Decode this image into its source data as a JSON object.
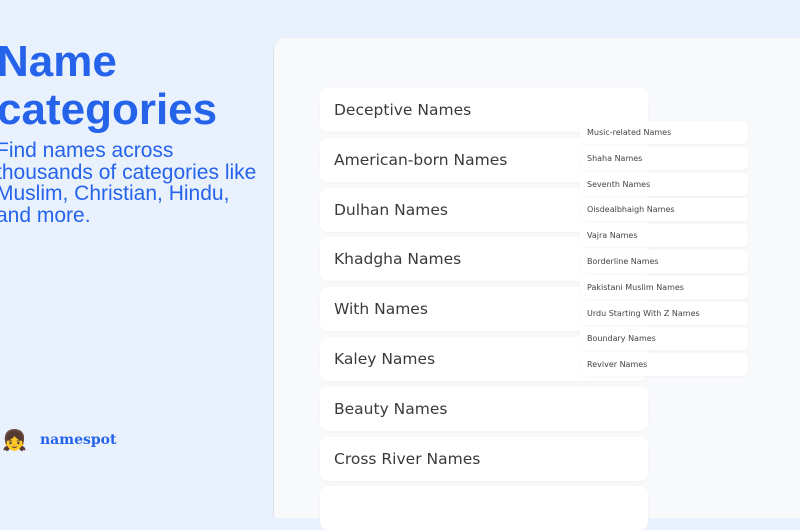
{
  "hero": {
    "title_line1": "Name",
    "title_line2": "categories",
    "description": "Find names across thousands of categories like Muslim, Christian, Hindu, and more."
  },
  "brand": {
    "emoji": "👧",
    "name": "namespot"
  },
  "categories": [
    "Deceptive Names",
    "American-born Names",
    "Dulhan Names",
    "Khadgha Names",
    "With Names",
    "Kaley Names",
    "Beauty Names",
    "Cross River Names",
    ""
  ],
  "mini_categories": [
    "Music-related Names",
    "Shaha Names",
    "Seventh Names",
    "Oisdealbhaigh Names",
    "Vajra Names",
    "Borderline Names",
    "Pakistani Muslim Names",
    "Urdu Starting With Z Names",
    "Boundary Names",
    "Reviver Names"
  ]
}
